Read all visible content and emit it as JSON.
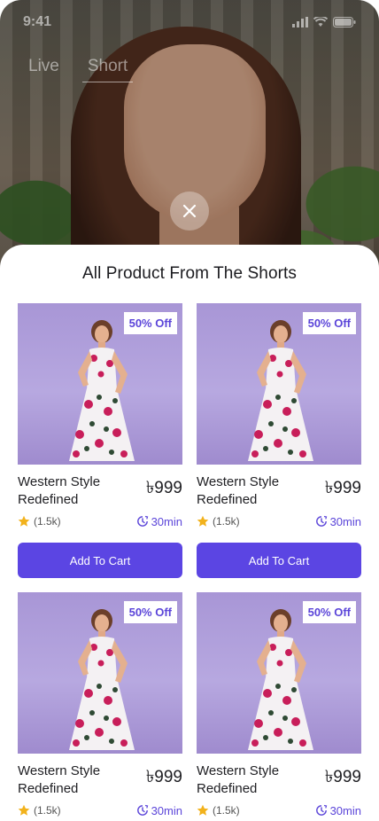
{
  "status_bar": {
    "time": "9:41"
  },
  "tabs": [
    {
      "label": "Live",
      "active": false
    },
    {
      "label": "Short",
      "active": true
    }
  ],
  "sheet": {
    "title": "All Product From The Shorts",
    "products": [
      {
        "name": "Western Style Redefined",
        "price": "৳999",
        "badge": "50% Off",
        "rating": "(1.5k)",
        "time": "30min",
        "cta": "Add To Cart"
      },
      {
        "name": "Western Style Redefined",
        "price": "৳999",
        "badge": "50% Off",
        "rating": "(1.5k)",
        "time": "30min",
        "cta": "Add To Cart"
      },
      {
        "name": "Western Style Redefined",
        "price": "৳999",
        "badge": "50% Off",
        "rating": "(1.5k)",
        "time": "30min",
        "cta": ""
      },
      {
        "name": "Western Style Redefined",
        "price": "৳999",
        "badge": "50% Off",
        "rating": "(1.5k)",
        "time": "30min",
        "cta": ""
      }
    ]
  },
  "colors": {
    "accent": "#5b45e3",
    "badge_text": "#5b45d9",
    "card_bg": "#b1a1de",
    "star": "#f2b21c"
  },
  "icons": [
    "signal-icon",
    "wifi-icon",
    "battery-icon",
    "close-icon",
    "star-icon",
    "timer-icon"
  ]
}
